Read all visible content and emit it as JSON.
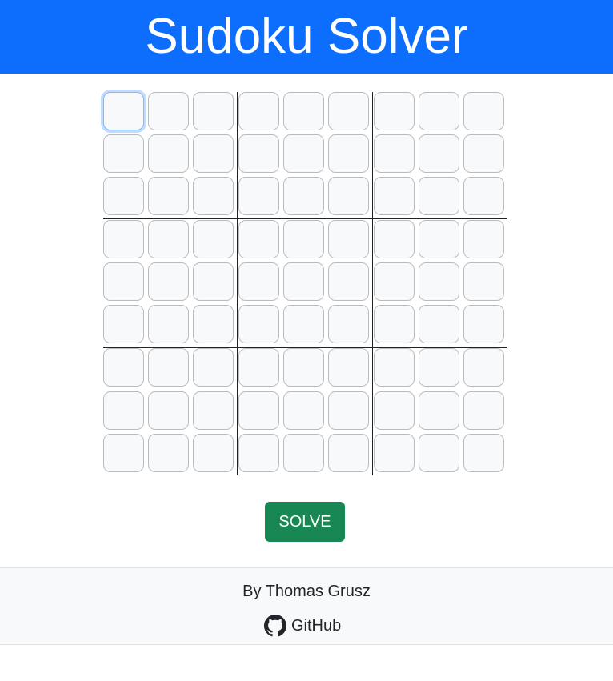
{
  "header": {
    "title": "Sudoku Solver"
  },
  "board": {
    "size": 9,
    "values": [
      [
        "",
        "",
        "",
        "",
        "",
        "",
        "",
        "",
        ""
      ],
      [
        "",
        "",
        "",
        "",
        "",
        "",
        "",
        "",
        ""
      ],
      [
        "",
        "",
        "",
        "",
        "",
        "",
        "",
        "",
        ""
      ],
      [
        "",
        "",
        "",
        "",
        "",
        "",
        "",
        "",
        ""
      ],
      [
        "",
        "",
        "",
        "",
        "",
        "",
        "",
        "",
        ""
      ],
      [
        "",
        "",
        "",
        "",
        "",
        "",
        "",
        "",
        ""
      ],
      [
        "",
        "",
        "",
        "",
        "",
        "",
        "",
        "",
        ""
      ],
      [
        "",
        "",
        "",
        "",
        "",
        "",
        "",
        "",
        ""
      ],
      [
        "",
        "",
        "",
        "",
        "",
        "",
        "",
        "",
        ""
      ]
    ],
    "focused_cell": [
      0,
      0
    ]
  },
  "actions": {
    "solve_label": "SOLVE"
  },
  "footer": {
    "author": "By Thomas Grusz",
    "github_label": "GitHub",
    "github_icon": "github-icon"
  },
  "colors": {
    "header_bg": "#0d6efd",
    "solve_bg": "#198754",
    "cell_bg": "#f8f9fa",
    "footer_bg": "#f8f9fa"
  }
}
